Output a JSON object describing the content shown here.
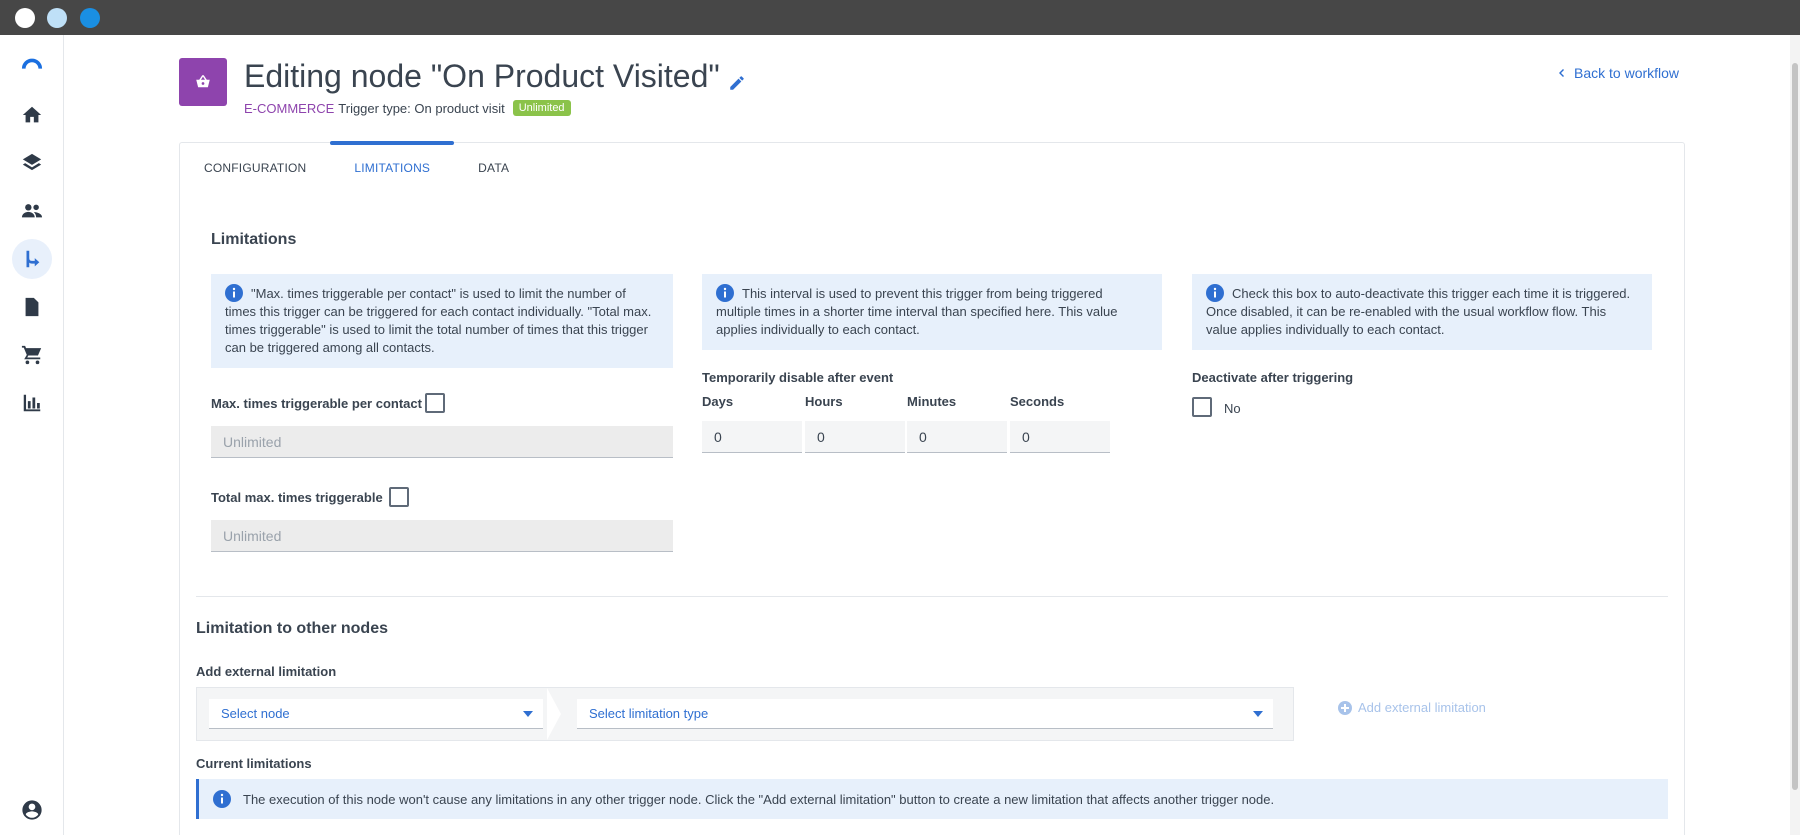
{
  "header": {
    "title": "Editing node \"On Product Visited\"",
    "category": "E-COMMERCE",
    "trigger_type": "Trigger type: On product visit",
    "badge": "Unlimited",
    "back_link": "Back to workflow"
  },
  "tabs": [
    {
      "label": "CONFIGURATION",
      "active": false
    },
    {
      "label": "LIMITATIONS",
      "active": true
    },
    {
      "label": "DATA",
      "active": false
    }
  ],
  "limitations": {
    "title": "Limitations",
    "info_left": "\"Max. times triggerable per contact\" is used to limit the number of times this trigger can be triggered for each contact individually. \"Total max. times triggerable\" is used to limit the total number of times that this trigger can be triggered among all contacts.",
    "info_middle": "This interval is used to prevent this trigger from being triggered multiple times in a shorter time interval than specified here. This value applies individually to each contact.",
    "info_right": "Check this box to auto-deactivate this trigger each time it is triggered. Once disabled, it can be re-enabled with the usual workflow flow. This value applies individually to each contact.",
    "max_per_contact_label": "Max. times triggerable per contact",
    "max_per_contact_value": "Unlimited",
    "total_max_label": "Total max. times triggerable",
    "total_max_value": "Unlimited",
    "disable_title": "Temporarily disable after event",
    "days_label": "Days",
    "hours_label": "Hours",
    "minutes_label": "Minutes",
    "seconds_label": "Seconds",
    "days_value": "0",
    "hours_value": "0",
    "minutes_value": "0",
    "seconds_value": "0",
    "deactivate_title": "Deactivate after triggering",
    "deactivate_value": "No"
  },
  "other_nodes": {
    "title": "Limitation to other nodes",
    "add_label": "Add external limitation",
    "select_node": "Select node",
    "select_type": "Select limitation type",
    "add_button": "Add external limitation",
    "current_label": "Current limitations",
    "current_info": "The execution of this node won't cause any limitations in any other trigger node. Click the \"Add external limitation\" button to create a new limitation that affects another trigger node."
  },
  "colors": {
    "accent": "#2f6fd1",
    "category": "#8e44ad",
    "badge": "#8bc34a",
    "info_bg": "#e7f0fb"
  },
  "icons": [
    "home-icon",
    "layers-icon",
    "people-icon",
    "workflow-icon",
    "document-icon",
    "cart-icon",
    "chart-icon",
    "account-icon"
  ]
}
